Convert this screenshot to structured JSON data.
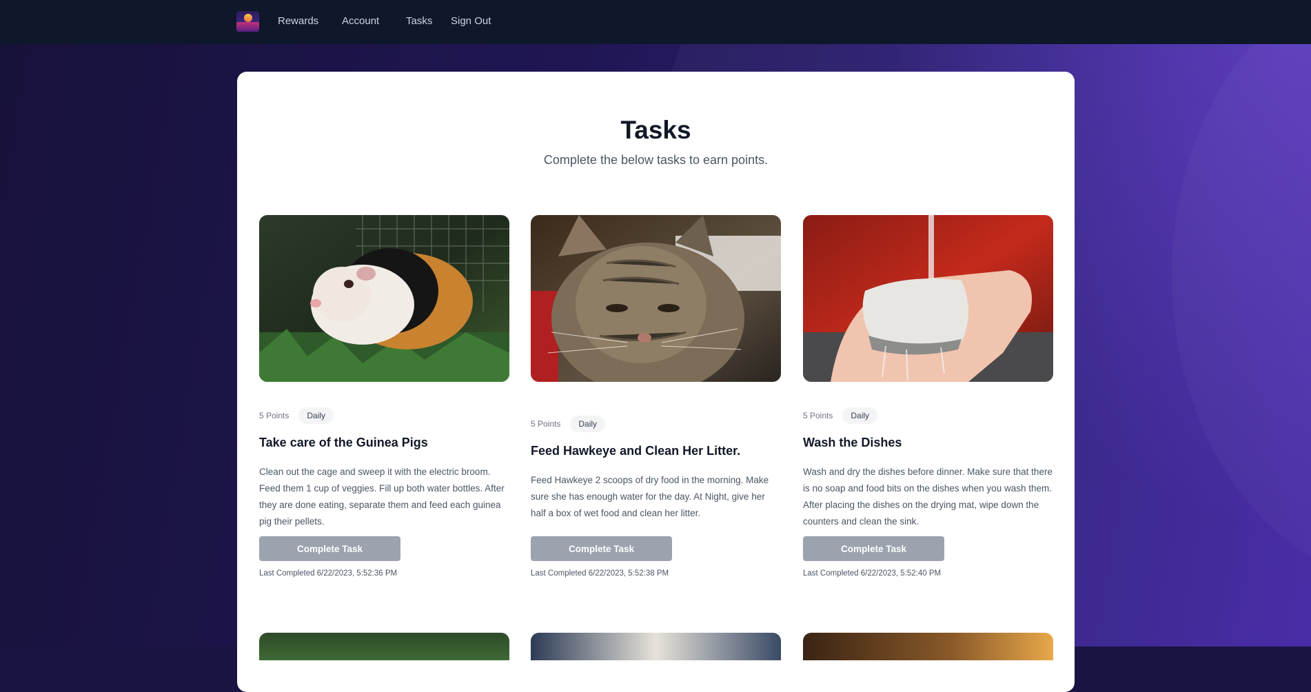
{
  "nav": {
    "logo_alt": "app-logo",
    "links": [
      "Rewards",
      "Account",
      "Tasks",
      "Sign Out"
    ]
  },
  "page": {
    "title": "Tasks",
    "subtitle": "Complete the below tasks to earn points."
  },
  "tasks": [
    {
      "points": "5 Points",
      "frequency": "Daily",
      "title": "Take care of the Guinea Pigs",
      "description": "Clean out the cage and sweep it with the electric broom. Feed them 1 cup of veggies. Fill up both water bottles. After they are done eating, separate them and feed each guinea pig their pellets.",
      "button": "Complete Task",
      "last_completed": "Last Completed 6/22/2023, 5:52:36 PM",
      "image": "guinea-pig-photo"
    },
    {
      "points": "5 Points",
      "frequency": "Daily",
      "title": "Feed Hawkeye and Clean Her Litter.",
      "description": "Feed Hawkeye 2 scoops of dry food in the morning. Make sure she has enough water for the day. At Night, give her half a box of wet food and clean her litter.",
      "button": "Complete Task",
      "last_completed": "Last Completed 6/22/2023, 5:52:38 PM",
      "image": "cat-photo"
    },
    {
      "points": "5 Points",
      "frequency": "Daily",
      "title": "Wash the Dishes",
      "description": "Wash and dry the dishes before dinner. Make sure that there is no soap and food bits on the dishes when you wash them. After placing the dishes on the drying mat, wipe down the counters and clean the sink.",
      "button": "Complete Task",
      "last_completed": "Last Completed 6/22/2023, 5:52:40 PM",
      "image": "washing-sponge-photo"
    }
  ],
  "colors": {
    "navbar": "#0f172a",
    "button": "#9ca3af",
    "card": "#ffffff",
    "background_accent": "#4326a4"
  }
}
